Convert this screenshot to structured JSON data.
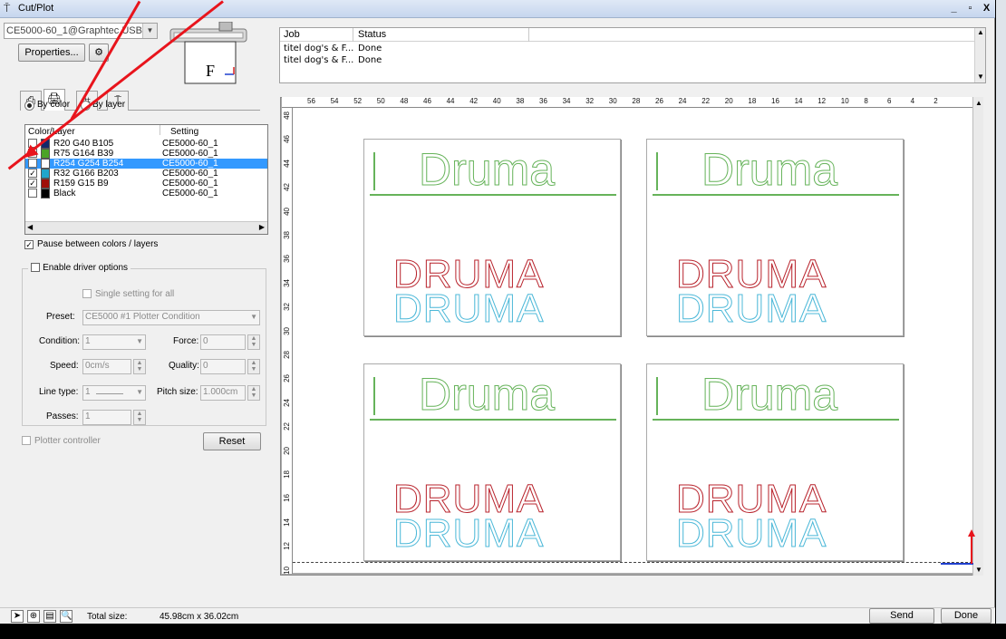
{
  "window": {
    "title": "Cut/Plot",
    "min": "_",
    "max": "▫",
    "close": "X"
  },
  "device": {
    "combo": "CE5000-60_1@Graphtec USB",
    "properties": "Properties...",
    "preview_label": "F"
  },
  "jobs": {
    "headers": [
      "Job",
      "Status"
    ],
    "rows": [
      {
        "job": "titel dog's & F...",
        "status": "Done"
      },
      {
        "job": "titel dog's & F...",
        "status": "Done"
      }
    ]
  },
  "mode": {
    "by_color": "By color",
    "by_layer": "By layer"
  },
  "color_table": {
    "headers": [
      "Color/Layer",
      "Setting"
    ],
    "rows": [
      {
        "label": "R20 G40 B105",
        "setting": "CE5000-60_1",
        "color": "#142869",
        "checked": false
      },
      {
        "label": "R75 G164 B39",
        "setting": "CE5000-60_1",
        "color": "#4ba427",
        "checked": true
      },
      {
        "label": "R254 G254 B254",
        "setting": "CE5000-60_1",
        "color": "#fefefe",
        "checked": false,
        "selected": true
      },
      {
        "label": "R32 G166 B203",
        "setting": "CE5000-60_1",
        "color": "#20a6cb",
        "checked": true
      },
      {
        "label": "R159 G15 B9",
        "setting": "CE5000-60_1",
        "color": "#9f0f09",
        "checked": true
      },
      {
        "label": "Black",
        "setting": "CE5000-60_1",
        "color": "#000000",
        "checked": false
      }
    ]
  },
  "options": {
    "pause": "Pause between colors / layers",
    "enable_driver": "Enable driver options",
    "single_setting": "Single setting for all",
    "preset_label": "Preset:",
    "preset_value": "CE5000 #1 Plotter Condition",
    "condition_label": "Condition:",
    "condition_value": "1",
    "force_label": "Force:",
    "force_value": "0",
    "speed_label": "Speed:",
    "speed_value": "0cm/s",
    "quality_label": "Quality:",
    "quality_value": "0",
    "linetype_label": "Line type:",
    "linetype_value": "1",
    "pitch_label": "Pitch size:",
    "pitch_value": "1.000cm",
    "passes_label": "Passes:",
    "passes_value": "1",
    "plotter_controller": "Plotter controller",
    "reset": "Reset"
  },
  "ruler": {
    "top": [
      "56",
      "54",
      "52",
      "50",
      "48",
      "46",
      "44",
      "42",
      "40",
      "38",
      "36",
      "34",
      "32",
      "30",
      "28",
      "26",
      "24",
      "22",
      "20",
      "18",
      "16",
      "14",
      "12",
      "10",
      "8",
      "6",
      "4",
      "2"
    ],
    "left": [
      "48",
      "46",
      "44",
      "42",
      "40",
      "38",
      "36",
      "34",
      "32",
      "30",
      "28",
      "26",
      "24",
      "22",
      "20",
      "18",
      "16",
      "14",
      "12",
      "10"
    ]
  },
  "design": {
    "script_word": "Druma",
    "caps_word": "DRUMA",
    "green": "#66b35a",
    "red": "#b8232c",
    "blue": "#4cb8d8"
  },
  "status": {
    "total_label": "Total size:",
    "total_value": "45.98cm x 36.02cm",
    "send": "Send",
    "done": "Done"
  }
}
